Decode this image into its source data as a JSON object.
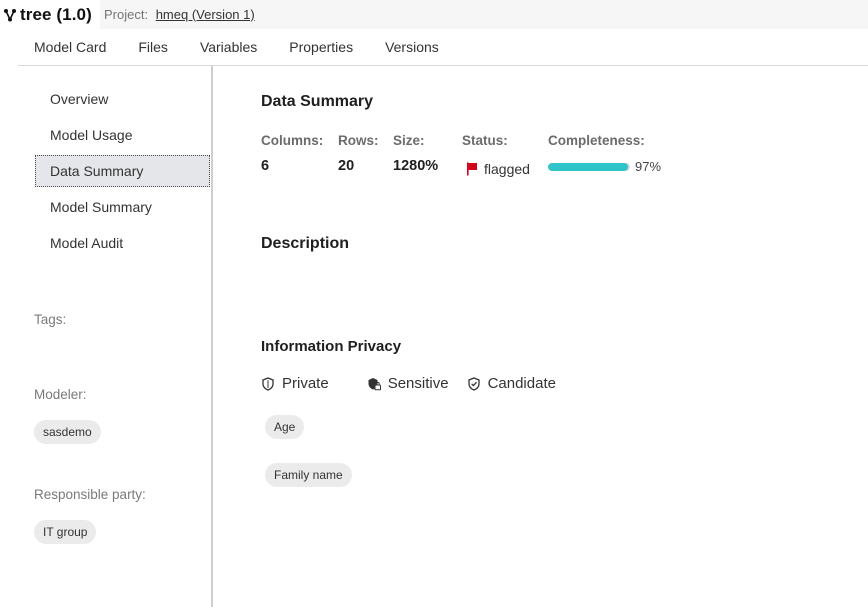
{
  "header": {
    "app_title": "tree (1.0)",
    "project_label": "Project:",
    "project_link": "hmeq (Version 1)"
  },
  "tabs": [
    {
      "label": "Model Card"
    },
    {
      "label": "Files"
    },
    {
      "label": "Variables"
    },
    {
      "label": "Properties"
    },
    {
      "label": "Versions"
    }
  ],
  "sidebar": {
    "items": [
      {
        "label": "Overview",
        "active": false
      },
      {
        "label": "Model Usage",
        "active": false
      },
      {
        "label": "Data Summary",
        "active": true
      },
      {
        "label": "Model Summary",
        "active": false
      },
      {
        "label": "Model Audit",
        "active": false
      }
    ],
    "tags_label": "Tags:",
    "modeler_label": "Modeler:",
    "modeler_value": "sasdemo",
    "responsible_label": "Responsible party:",
    "responsible_value": "IT group"
  },
  "main": {
    "title": "Data Summary",
    "stats": {
      "columns_label": "Columns:",
      "columns_value": "6",
      "rows_label": "Rows:",
      "rows_value": "20",
      "size_label": "Size:",
      "size_value": "1280%",
      "status_label": "Status:",
      "status_value": "flagged",
      "completeness_label": "Completeness:",
      "completeness_value": "97%",
      "completeness_fraction": 0.97
    },
    "description_title": "Description",
    "privacy_title": "Information Privacy",
    "privacy_options": {
      "private": "Private",
      "sensitive": "Sensitive",
      "candidate": "Candidate"
    },
    "privacy_tags": [
      "Age",
      "Family name"
    ]
  },
  "colors": {
    "accent_bar": "#2ec4c9",
    "flag_red": "#d0021b"
  },
  "icons": {
    "title": "branch-icon",
    "status": "flag-icon",
    "private": "shield-icon",
    "sensitive": "lock-shield-icon",
    "candidate": "shield-check-icon"
  }
}
